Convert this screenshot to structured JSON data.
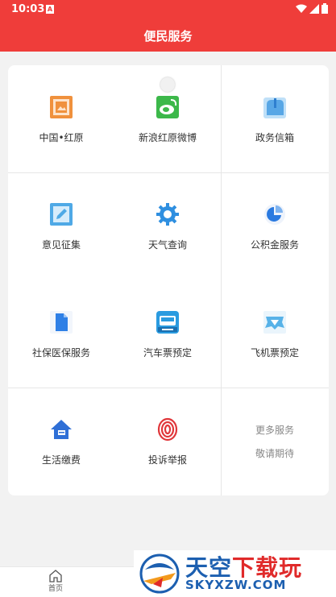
{
  "status": {
    "time": "10:03",
    "indicator": "A"
  },
  "header": {
    "title": "便民服务"
  },
  "grid": {
    "items": [
      {
        "label": "中国•红原",
        "icon": "picture-icon",
        "color": "#f0913d"
      },
      {
        "label": "新浪红原微博",
        "icon": "weibo-icon",
        "color": "#3cb84a"
      },
      {
        "label": "政务信箱",
        "icon": "mailbox-icon",
        "color": "#58a7e6"
      },
      {
        "label": "意见征集",
        "icon": "edit-icon",
        "color": "#4fa9e6"
      },
      {
        "label": "天气查询",
        "icon": "gear-icon",
        "color": "#2f8fe0"
      },
      {
        "label": "公积金服务",
        "icon": "pie-chart-icon",
        "color": "#2a7ae0"
      },
      {
        "label": "社保医保服务",
        "icon": "document-icon",
        "color": "#2f80e6"
      },
      {
        "label": "汽车票预定",
        "icon": "bus-icon",
        "color": "#2a9be0"
      },
      {
        "label": "飞机票预定",
        "icon": "airplane-icon",
        "color": "#57b2e8"
      },
      {
        "label": "生活缴费",
        "icon": "house-icon",
        "color": "#2f6fd6"
      },
      {
        "label": "投诉举报",
        "icon": "fingerprint-icon",
        "color": "#e0363a"
      }
    ],
    "more_line1": "更多服务",
    "more_line2": "敬请期待"
  },
  "tabbar": {
    "home_label": "首页"
  },
  "watermark": {
    "title_part1": "天空",
    "title_part2": "下载玩",
    "domain": "SKYXZW.COM"
  },
  "colors": {
    "brand": "#ef3d3a",
    "background": "#f2f2f2"
  }
}
